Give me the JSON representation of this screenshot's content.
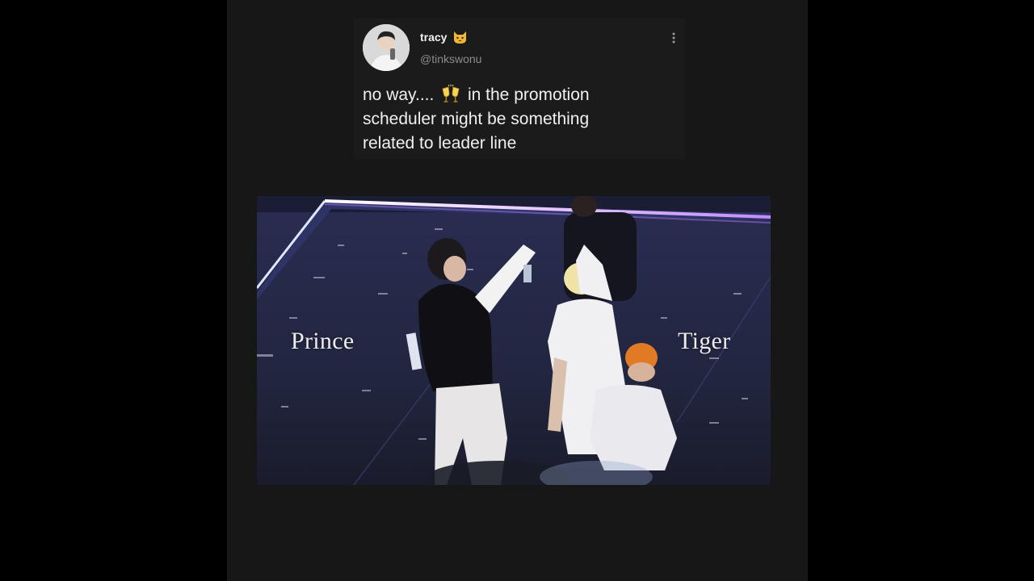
{
  "tweet": {
    "display_name": "tracy",
    "handle": "@tinkswonu",
    "avatar_label": "user avatar",
    "name_emoji": "cat-face-emoji",
    "more_icon": "more-vertical-icon",
    "text_line_1_before": "no way.... ",
    "text_line_1_emoji": "clinking-glasses-emoji",
    "text_line_1_after": " in the promotion",
    "text_line_2": "scheduler might be something",
    "text_line_3": "related to leader line"
  },
  "media": {
    "caption_left": "Prince",
    "caption_right": "Tiger"
  },
  "colors": {
    "background": "#000000",
    "panel": "#171717",
    "tweet_text": "#f0f0f0",
    "handle": "#8c8c8c",
    "stage_glow": "#c8a0ff"
  }
}
